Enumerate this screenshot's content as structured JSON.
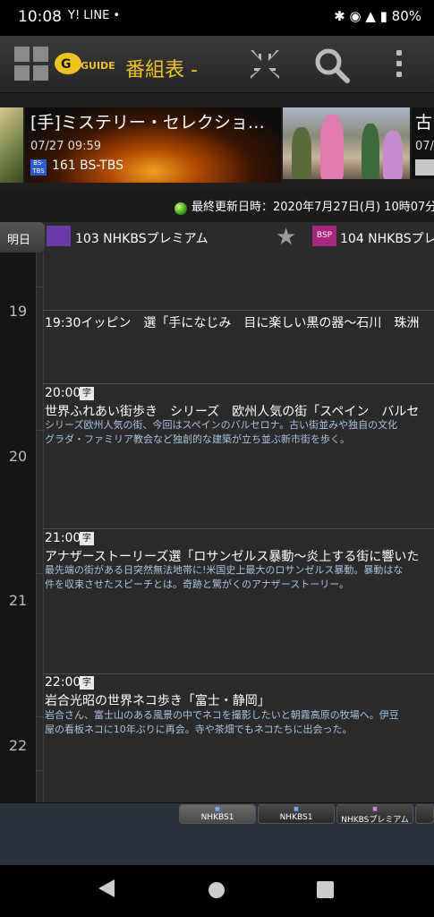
{
  "status_bar": {
    "time": "10:08",
    "left_icons": "Y! LINE •",
    "battery": "80%"
  },
  "app_bar": {
    "title": "番組表 -",
    "logo_text": "G GUIDE"
  },
  "featured": [
    {
      "title": "[手]ミステリー・セレクショ…",
      "datetime": "07/27 09:59",
      "channel": "161 BS-TBS",
      "badge": "BS-TBS"
    },
    {
      "title": "古",
      "datetime": "07/"
    }
  ],
  "update_status": "最終更新日時：2020年7月27日(月) 10時07分",
  "channel_header": {
    "prev_day_label": "明日",
    "channels": [
      {
        "name": "103 NHKBSプレミアム"
      },
      {
        "name": "104 NHKBSプレ",
        "badge": "BSP"
      }
    ]
  },
  "timetable": {
    "hours": [
      "19",
      "20",
      "21",
      "22"
    ],
    "programs": [
      {
        "time": "",
        "title": "19:30イッピン　選「手になじみ　目に楽しい黒の器〜石川　珠洲",
        "desc": []
      },
      {
        "time": "20:00",
        "badge": "字",
        "title": "世界ふれあい街歩き　シリーズ　欧州人気の街「スペイン　バルセ",
        "desc": [
          "シリーズ欧州人気の街、今回はスペインのバルセロナ。古い街並みや独自の文化",
          "グラダ・ファミリア教会など独創的な建築が立ち並ぶ新市街を歩く。"
        ]
      },
      {
        "time": "21:00",
        "badge": "字",
        "title": "アナザーストーリーズ選「ロサンゼルス暴動〜炎上する街に響いた",
        "desc": [
          "最先端の街がある日突然無法地帯に!米国史上最大のロサンゼルス暴動。暴動はな",
          "件を収束させたスピーチとは。奇跡と驚がくのアナザーストーリー。"
        ]
      },
      {
        "time": "22:00",
        "badge": "字",
        "title": "岩合光昭の世界ネコ歩き「富士・静岡」",
        "desc": [
          "岩合さん、富士山のある風景の中でネコを撮影したいと朝霧高原の牧場へ。伊豆",
          "屋の看板ネコに10年ぶりに再会。寺や茶畑でもネコたちに出会った。"
        ]
      }
    ]
  },
  "channel_tabs": [
    "NHKBS1",
    "NHKBS1",
    "NHKBSプレミアム"
  ],
  "colors": {
    "accent": "#f0c419",
    "desc_text": "#a8c4e0",
    "background": "#1b1b1b"
  }
}
